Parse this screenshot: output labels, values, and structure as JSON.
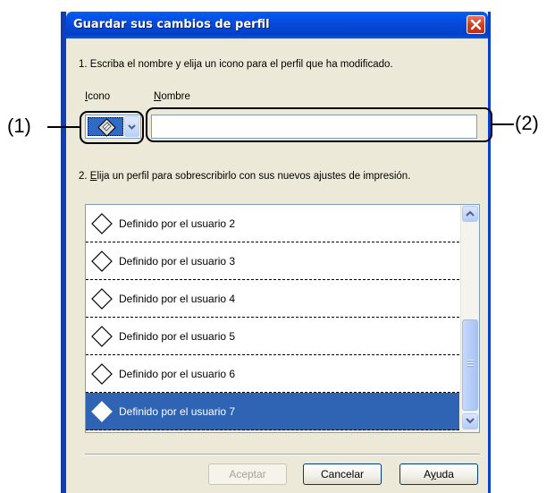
{
  "dialog": {
    "title": "Guardar sus cambios de perfil",
    "step1": "1. Escriba el nombre y elija un icono para el perfil que ha modificado.",
    "icon_label": "Icono",
    "name_label": "Nombre",
    "name_value": "",
    "step2_prefix": "2. ",
    "step2_accel": "E",
    "step2_rest": "lija un perfil para sobrescribirlo con sus nuevos ajustes de impresión.",
    "profiles": [
      {
        "label": "Definido por el usuario 2",
        "selected": false
      },
      {
        "label": "Definido por el usuario 3",
        "selected": false
      },
      {
        "label": "Definido por el usuario 4",
        "selected": false
      },
      {
        "label": "Definido por el usuario 5",
        "selected": false
      },
      {
        "label": "Definido por el usuario 6",
        "selected": false
      },
      {
        "label": "Definido por el usuario 7",
        "selected": true
      }
    ],
    "buttons": {
      "accept": "Aceptar",
      "cancel": "Cancelar",
      "help": "Ayuda"
    },
    "profile_icon": "diamond-icon"
  },
  "callouts": {
    "left": "(1)",
    "right": "(2)"
  },
  "colors": {
    "title_bar": "#0848d8",
    "selection": "#2f64b4",
    "dialog_bg": "#ece9d8",
    "close_button": "#d6381a"
  }
}
